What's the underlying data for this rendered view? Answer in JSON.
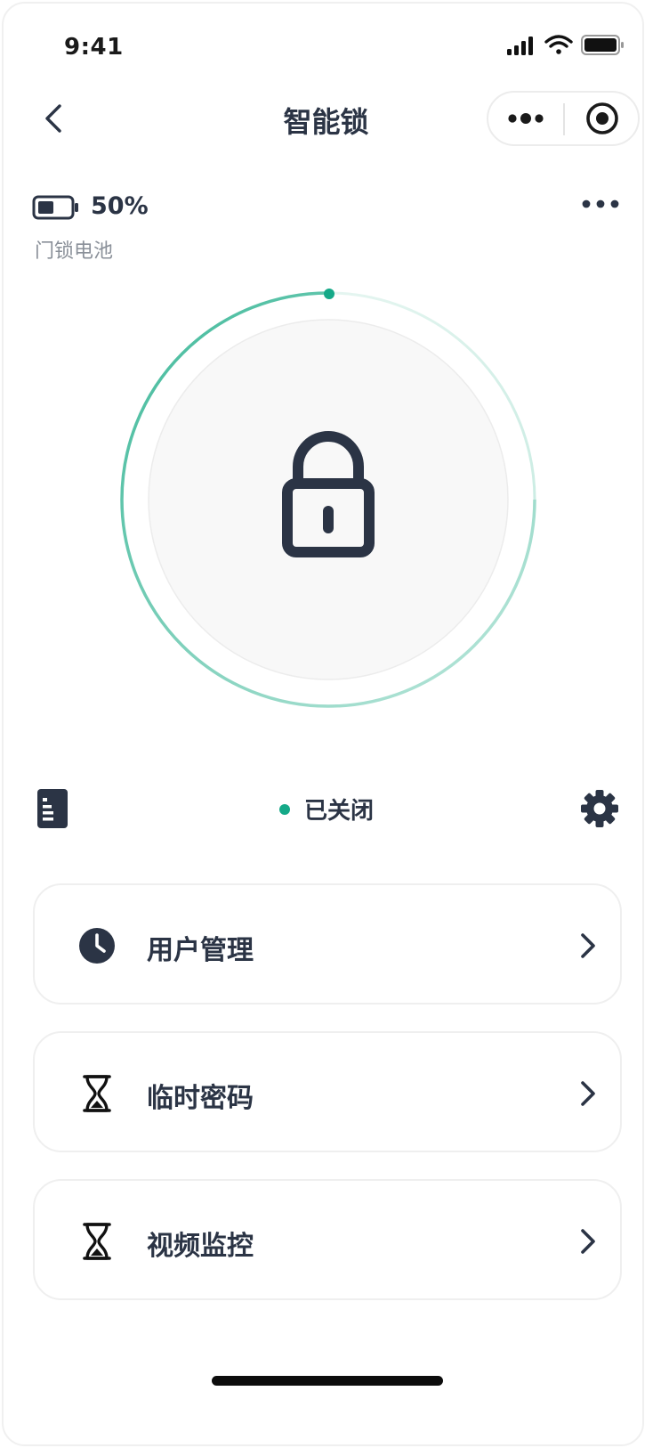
{
  "status_bar": {
    "time": "9:41",
    "icons": [
      "signal-icon",
      "wifi-icon",
      "battery-icon"
    ]
  },
  "nav": {
    "title": "智能锁",
    "back_icon": "chevron-left-icon",
    "more_icon": "more-dots-icon",
    "close_icon": "target-icon"
  },
  "battery": {
    "percent_text": "50%",
    "label": "门锁电池",
    "level": 0.5
  },
  "lock": {
    "icon": "padlock-icon",
    "state_text": "已关闭",
    "state_color": "#15a988"
  },
  "toolbar": {
    "log_icon": "document-icon",
    "settings_icon": "gear-icon"
  },
  "menu": [
    {
      "label": "用户管理",
      "icon": "clock-icon"
    },
    {
      "label": "临时密码",
      "icon": "hourglass-icon"
    },
    {
      "label": "视频监控",
      "icon": "hourglass-icon"
    }
  ],
  "colors": {
    "accent": "#15a988",
    "ring_start": "#3fb99a",
    "ring_end": "#d2efe8",
    "text_primary": "#2b3445",
    "text_secondary": "#8a9099"
  }
}
